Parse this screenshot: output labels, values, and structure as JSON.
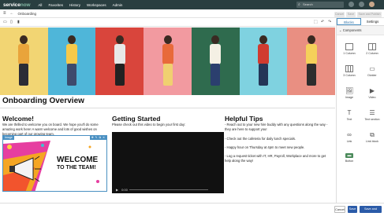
{
  "topnav": {
    "logo_a": "service",
    "logo_b": "now",
    "items": [
      "All",
      "Favorites",
      "History",
      "Workspaces",
      "Admin"
    ],
    "search_placeholder": "Search"
  },
  "toolbar": {
    "page_name": "Onboarding",
    "btn_cancel": "Cancel",
    "btn_save": "Save",
    "btn_save_publish": "Save and Publish"
  },
  "page": {
    "title": "Onboarding Overview",
    "columns": [
      {
        "title": "Welcome!",
        "text": "We are thrilled to welcome you on board. We hope you'll do some amazing work here! A warm welcome and lots of good wishes on becoming part of our growing team."
      },
      {
        "title": "Getting Started",
        "text": "Please check out this video to begin your first day:"
      },
      {
        "title": "Helpful Tips",
        "tips": [
          "- Reach out to your new hire buddy with any questions along the way - they are here to support you!",
          "- Check out the cafeteria for daily lunch specials.",
          "- Happy hour on Thursday at 4pm to meet new people.",
          "- Log a request ticket with IT, HR, Payroll, Workplace and more to get help along the way!"
        ]
      }
    ],
    "image_tag": "Image",
    "image_text_1": "WELCOME",
    "image_text_2": "TO THE TEAM!",
    "video_time": "0:00"
  },
  "sidebar": {
    "tabs": [
      "Blocks",
      "Settings"
    ],
    "section": "Components",
    "components": [
      "1 Column",
      "2 Column",
      "3 Column",
      "Divider",
      "Image",
      "Video",
      "Text",
      "Text section",
      "Link",
      "Link block",
      "Button"
    ]
  },
  "footer": {
    "cancel": "Cancel",
    "save": "Save",
    "save_publish": "Save and Publish"
  },
  "colors": {
    "nav_bg": "#293e40",
    "accent": "#2b6fa6",
    "publish_btn": "#2b5ba8"
  }
}
